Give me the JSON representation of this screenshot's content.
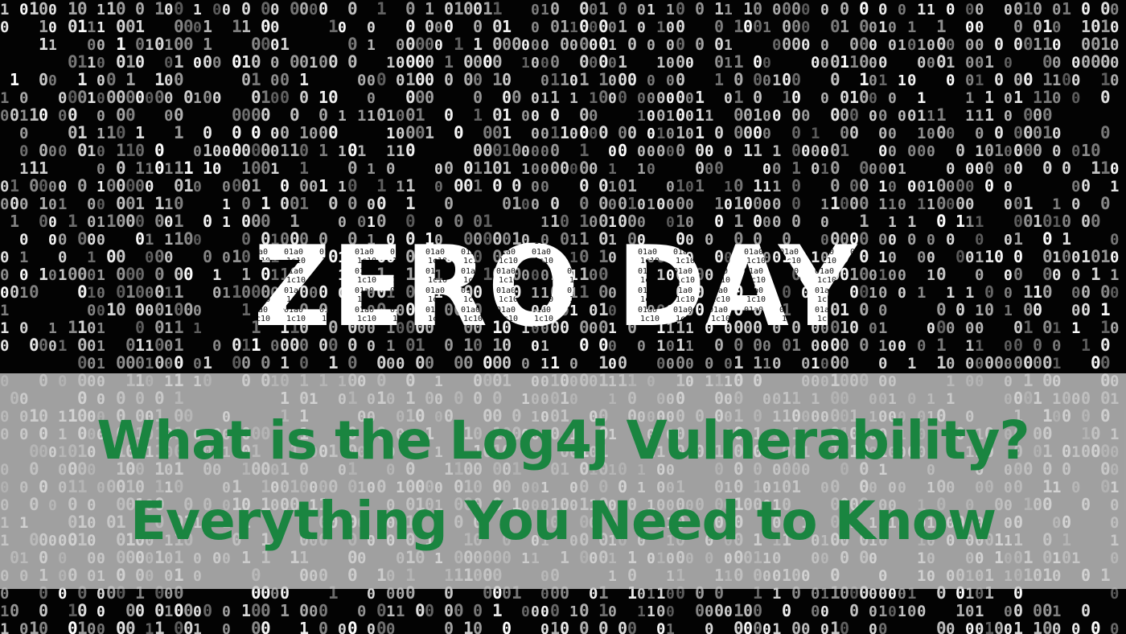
{
  "hero": {
    "text": "ZERO DAY"
  },
  "title": {
    "line1": "What is the Log4j Vulnerability?",
    "line2": "Everything You Need to Know",
    "color": "#1a8540"
  },
  "background": {
    "style": "binary-code-rain",
    "glyphs": "01",
    "color": "#000000"
  }
}
